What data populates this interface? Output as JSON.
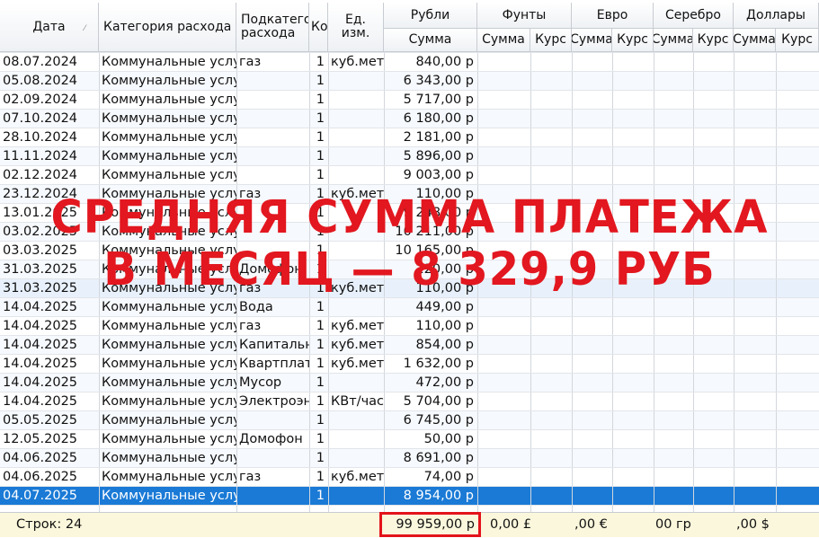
{
  "headers": {
    "date": "Дата",
    "category": "Категория расхода",
    "subcategory": "Подкатегория расхода",
    "count": "Количество",
    "unit": "Ед. изм.",
    "rub_group": "Рубли",
    "rub_sum": "Сумма",
    "gbp_group": "Фунты",
    "eur_group": "Евро",
    "silver_group": "Серебро",
    "usd_group": "Доллары",
    "sum": "Сумма",
    "rate": "Курс"
  },
  "rows": [
    {
      "date": "08.07.2024",
      "category": "Коммунальные услуги",
      "sub": "газ",
      "count": "1",
      "unit": "куб.мет",
      "rub": "840,00 р"
    },
    {
      "date": "05.08.2024",
      "category": "Коммунальные услуги",
      "sub": "",
      "count": "1",
      "unit": "",
      "rub": "6 343,00 р"
    },
    {
      "date": "02.09.2024",
      "category": "Коммунальные услуги",
      "sub": "",
      "count": "1",
      "unit": "",
      "rub": "5 717,00 р"
    },
    {
      "date": "07.10.2024",
      "category": "Коммунальные услуги",
      "sub": "",
      "count": "1",
      "unit": "",
      "rub": "6 180,00 р"
    },
    {
      "date": "28.10.2024",
      "category": "Коммунальные услуги",
      "sub": "",
      "count": "1",
      "unit": "",
      "rub": "2 181,00 р"
    },
    {
      "date": "11.11.2024",
      "category": "Коммунальные услуги",
      "sub": "",
      "count": "1",
      "unit": "",
      "rub": "5 896,00 р"
    },
    {
      "date": "02.12.2024",
      "category": "Коммунальные услуги",
      "sub": "",
      "count": "1",
      "unit": "",
      "rub": "9 003,00 р"
    },
    {
      "date": "23.12.2024",
      "category": "Коммунальные услуги",
      "sub": "газ",
      "count": "1",
      "unit": "куб.мет",
      "rub": "110,00 р"
    },
    {
      "date": "13.01.2025",
      "category": "Коммунальные услуги",
      "sub": "",
      "count": "1",
      "unit": "",
      "rub": "9 248,00 р"
    },
    {
      "date": "03.02.2025",
      "category": "Коммунальные услуги",
      "sub": "",
      "count": "1",
      "unit": "",
      "rub": "10 211,00 р"
    },
    {
      "date": "03.03.2025",
      "category": "Коммунальные услуги",
      "sub": "",
      "count": "1",
      "unit": "",
      "rub": "10 165,00 р"
    },
    {
      "date": "31.03.2025",
      "category": "Коммунальные услуги",
      "sub": "Домофон",
      "count": "1",
      "unit": "",
      "rub": "220,00 р"
    },
    {
      "date": "31.03.2025",
      "category": "Коммунальные услуги",
      "sub": "газ",
      "count": "1",
      "unit": "куб.мет",
      "rub": "110,00 р"
    },
    {
      "date": "14.04.2025",
      "category": "Коммунальные услуги",
      "sub": "Вода",
      "count": "1",
      "unit": "",
      "rub": "449,00 р"
    },
    {
      "date": "14.04.2025",
      "category": "Коммунальные услуги",
      "sub": "газ",
      "count": "1",
      "unit": "куб.мет",
      "rub": "110,00 р"
    },
    {
      "date": "14.04.2025",
      "category": "Коммунальные услуги",
      "sub": "Капитальный ремонт",
      "count": "1",
      "unit": "куб.мет",
      "rub": "854,00 р"
    },
    {
      "date": "14.04.2025",
      "category": "Коммунальные услуги",
      "sub": "Квартплата",
      "count": "1",
      "unit": "куб.мет",
      "rub": "1 632,00 р"
    },
    {
      "date": "14.04.2025",
      "category": "Коммунальные услуги",
      "sub": "Мусор",
      "count": "1",
      "unit": "",
      "rub": "472,00 р"
    },
    {
      "date": "14.04.2025",
      "category": "Коммунальные услуги",
      "sub": "Электроэнергия",
      "count": "1",
      "unit": "КВт/час",
      "rub": "5 704,00 р"
    },
    {
      "date": "05.05.2025",
      "category": "Коммунальные услуги",
      "sub": "",
      "count": "1",
      "unit": "",
      "rub": "6 745,00 р"
    },
    {
      "date": "12.05.2025",
      "category": "Коммунальные услуги",
      "sub": "Домофон",
      "count": "1",
      "unit": "",
      "rub": "50,00 р"
    },
    {
      "date": "04.06.2025",
      "category": "Коммунальные услуги",
      "sub": "",
      "count": "1",
      "unit": "",
      "rub": "8 691,00 р"
    },
    {
      "date": "04.06.2025",
      "category": "Коммунальные услуги",
      "sub": "газ",
      "count": "1",
      "unit": "куб.мет",
      "rub": "74,00 р"
    },
    {
      "date": "04.07.2025",
      "category": "Коммунальные услуги",
      "sub": "",
      "count": "1",
      "unit": "",
      "rub": "8 954,00 р"
    }
  ],
  "footer": {
    "rows_count": "Строк: 24",
    "rub_total": "99 959,00 р",
    "gbp_total": "0,00 £",
    "eur_total": ",00 €",
    "silver_total": "00 гр",
    "usd_total": ",00 $"
  },
  "overlay": {
    "line1": "СРЕДНЯЯ СУММА ПЛАТЕЖА",
    "line2": "В МЕСЯЦ — 8 329,9 РУБ"
  },
  "colors": {
    "selection": "#1a7ad6",
    "overlay_text": "#e2171f",
    "total_box": "#e3131b",
    "footer_bg": "#fbf7dc"
  }
}
